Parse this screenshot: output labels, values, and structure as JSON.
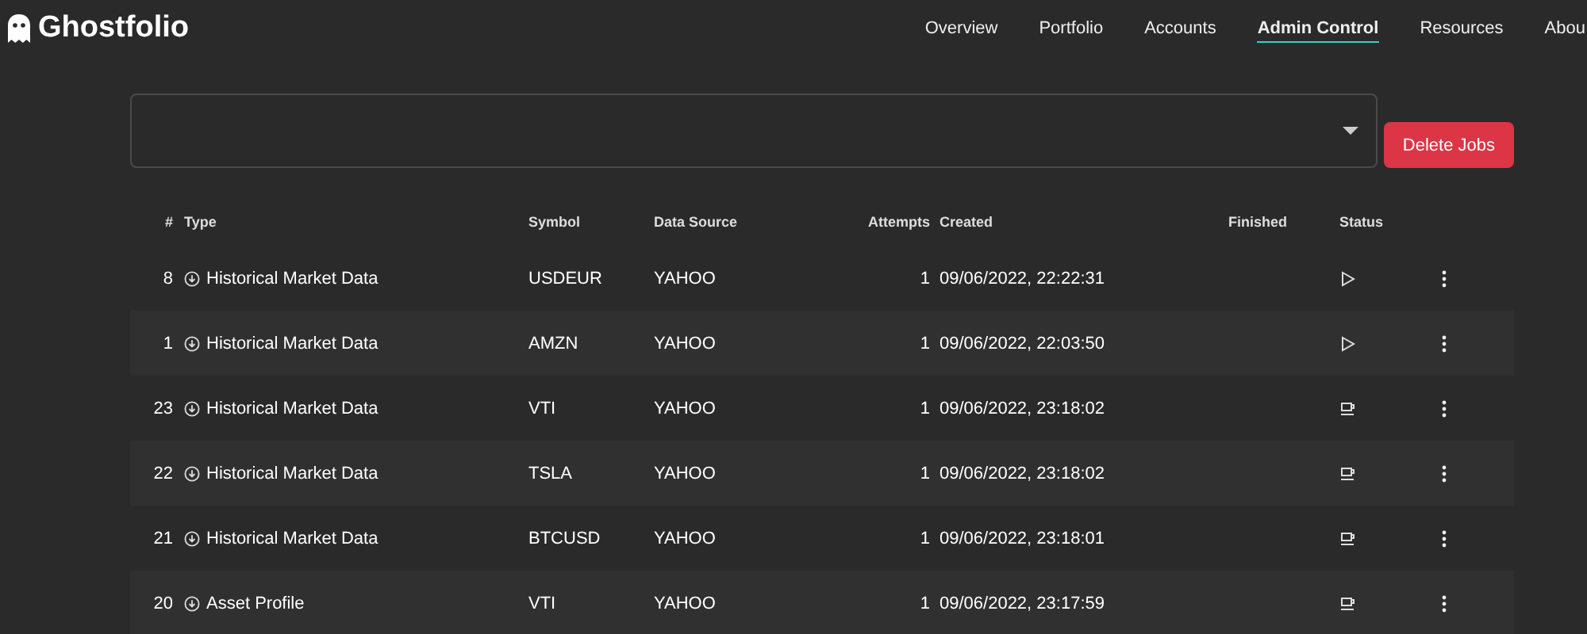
{
  "app": {
    "name": "Ghostfolio"
  },
  "nav": [
    {
      "label": "Overview",
      "selected": false
    },
    {
      "label": "Portfolio",
      "selected": false
    },
    {
      "label": "Accounts",
      "selected": false
    },
    {
      "label": "Admin Control",
      "selected": true
    },
    {
      "label": "Resources",
      "selected": false
    },
    {
      "label": "Abou",
      "selected": false
    }
  ],
  "delete_button": "Delete Jobs",
  "table": {
    "columns": [
      "#",
      "Type",
      "Symbol",
      "Data Source",
      "Attempts",
      "Created",
      "Finished",
      "Status"
    ],
    "rows": [
      {
        "id": "8",
        "type": "Historical Market Data",
        "symbol": "USDEUR",
        "source": "YAHOO",
        "attempts": "1",
        "created": "09/06/2022, 22:22:31",
        "kind": "active"
      },
      {
        "id": "1",
        "type": "Historical Market Data",
        "symbol": "AMZN",
        "source": "YAHOO",
        "attempts": "1",
        "created": "09/06/2022, 22:03:50",
        "kind": "active"
      },
      {
        "id": "23",
        "type": "Historical Market Data",
        "symbol": "VTI",
        "source": "YAHOO",
        "attempts": "1",
        "created": "09/06/2022, 23:18:02",
        "kind": "waiting"
      },
      {
        "id": "22",
        "type": "Historical Market Data",
        "symbol": "TSLA",
        "source": "YAHOO",
        "attempts": "1",
        "created": "09/06/2022, 23:18:02",
        "kind": "waiting"
      },
      {
        "id": "21",
        "type": "Historical Market Data",
        "symbol": "BTCUSD",
        "source": "YAHOO",
        "attempts": "1",
        "created": "09/06/2022, 23:18:01",
        "kind": "waiting"
      },
      {
        "id": "20",
        "type": "Asset Profile",
        "symbol": "VTI",
        "source": "YAHOO",
        "attempts": "1",
        "created": "09/06/2022, 23:17:59",
        "kind": "waiting"
      }
    ]
  }
}
